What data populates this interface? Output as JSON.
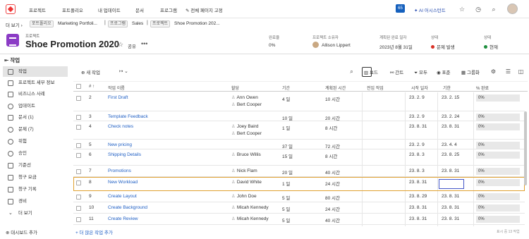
{
  "topnav": {
    "items": [
      "프로젝트",
      "포트폴리오",
      "내 업데이트",
      "문서",
      "프로그램",
      "전체 페이지 고정"
    ],
    "badge": "65",
    "ai_label": "AI 어시스턴트"
  },
  "breadcrumb": {
    "more": "더 보기",
    "portfolio_tag": "포트폴리오",
    "portfolio": "Marketing Portfoli...",
    "program_tag": "프로그램",
    "program": "Sales",
    "project_tag": "프로젝트",
    "project": "Shoe Promotion 202..."
  },
  "project": {
    "type_label": "프로젝트",
    "title": "Shoe Promotion 2020",
    "share": "공유",
    "complete_label": "완료율",
    "complete_value": "0%",
    "owner_label": "프로젝트 소유자",
    "owner_value": "Allison Lippert",
    "planned_label": "계획된 완료 일자",
    "planned_value": "2023년 8월 31일",
    "condition_label": "상태",
    "condition_value": "문제 발생",
    "status_label": "상태",
    "status_value": "현재",
    "condition_color": "#d93025",
    "status_color": "#1e8e3e"
  },
  "sidebar": {
    "collapse": "작업",
    "items": [
      {
        "label": "작업",
        "icon": "task-icon"
      },
      {
        "label": "프로젝트 세부 정보",
        "icon": "details-icon"
      },
      {
        "label": "비즈니스 사례",
        "icon": "business-case-icon"
      },
      {
        "label": "업데이트",
        "icon": "updates-icon"
      },
      {
        "label": "문서 (1)",
        "icon": "documents-icon"
      },
      {
        "label": "문제 (7)",
        "icon": "issues-icon"
      },
      {
        "label": "위험",
        "icon": "risk-icon"
      },
      {
        "label": "승인",
        "icon": "approvals-icon"
      },
      {
        "label": "기준선",
        "icon": "baseline-icon"
      },
      {
        "label": "청구 요금",
        "icon": "billing-rates-icon"
      },
      {
        "label": "청구 기록",
        "icon": "billing-records-icon"
      },
      {
        "label": "경비",
        "icon": "expenses-icon"
      },
      {
        "label": "더 보기",
        "icon": "more-icon"
      }
    ],
    "footer": "대시보드 추가"
  },
  "toolbar": {
    "new_task": "새 작업",
    "board": "보드",
    "gantt": "간트",
    "all": "모두",
    "standard": "표준",
    "grouping": "그룹화"
  },
  "table": {
    "headers": [
      "#",
      "작업 이름",
      "할당",
      "기간",
      "계획된 시간",
      "전임 작업",
      "시작 일자",
      "기한",
      "% 완료"
    ],
    "rows": [
      {
        "num": "2",
        "name": "First Draft",
        "assign": [
          "Ann Owen",
          "Bert Cooper"
        ],
        "duration": "4 일",
        "hours": "10 시간",
        "pred": "",
        "start": "23. 2. 9",
        "due": "23. 2. 15",
        "pct": "0%"
      },
      {
        "num": "3",
        "name": "Template Feedback",
        "assign": [],
        "duration": "10 일",
        "hours": "20 시간",
        "pred": "",
        "start": "23. 2. 9",
        "due": "23. 2. 24",
        "pct": "0%"
      },
      {
        "num": "4",
        "name": "Check notes",
        "assign": [
          "Joey Baird",
          "Bert Cooper"
        ],
        "duration": "1 일",
        "hours": "8 시간",
        "pred": "",
        "start": "23. 8. 31",
        "due": "23. 8. 31",
        "pct": "0%"
      },
      {
        "num": "5",
        "name": "New pricing",
        "assign": [],
        "duration": "37 일",
        "hours": "72 시간",
        "pred": "",
        "start": "23. 2. 9",
        "due": "23. 4. 4",
        "pct": "0%"
      },
      {
        "num": "6",
        "name": "Shipping Details",
        "assign": [
          "Bruce Willis"
        ],
        "duration": "15 일",
        "hours": "8 시간",
        "pred": "",
        "start": "23. 8. 3",
        "due": "23. 8. 25",
        "pct": "0%"
      },
      {
        "num": "7",
        "name": "Promotions",
        "assign": [
          "Nick Flam"
        ],
        "duration": "20 일",
        "hours": "40 시간",
        "pred": "",
        "start": "23. 8. 3",
        "due": "23. 8. 31",
        "pct": "0%"
      },
      {
        "num": "8",
        "name": "New Workload",
        "assign": [
          "David White"
        ],
        "duration": "1 일",
        "hours": "24 시간",
        "pred": "",
        "start": "23. 8. 31",
        "due": "23. 8. 31",
        "pct": "0%"
      },
      {
        "num": "9",
        "name": "Create Layout",
        "assign": [
          "John Doe"
        ],
        "duration": "5 일",
        "hours": "80 시간",
        "pred": "",
        "start": "23. 8. 29",
        "due": "23. 8. 31",
        "pct": "0%"
      },
      {
        "num": "10",
        "name": "Create Background",
        "assign": [
          "Micah Kennedy"
        ],
        "duration": "5 일",
        "hours": "24 시간",
        "pred": "",
        "start": "23. 8. 31",
        "due": "23. 8. 31",
        "pct": "0%"
      },
      {
        "num": "11",
        "name": "Create Review",
        "assign": [
          "Micah Kennedy"
        ],
        "duration": "5 일",
        "hours": "40 시간",
        "pred": "",
        "start": "23. 8. 31",
        "due": "23. 8. 31",
        "pct": "0%"
      }
    ],
    "add_more": "+ 더 많은 작업 추가",
    "footnote": "표시 중 13 작업"
  }
}
